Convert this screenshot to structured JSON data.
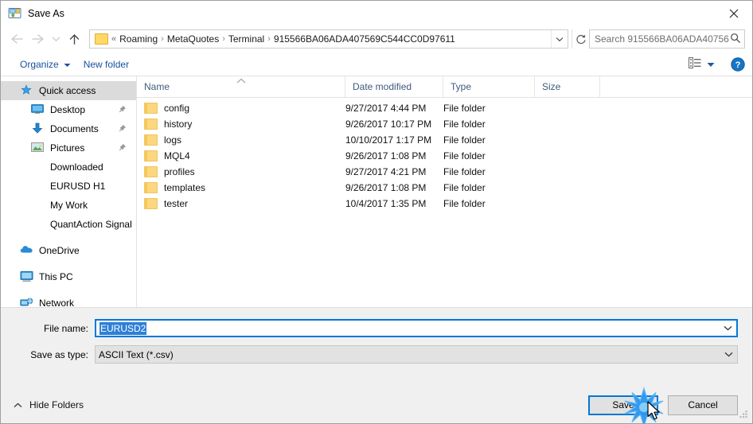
{
  "window": {
    "title": "Save As",
    "icon": "save-as-icon",
    "close_label": "✕"
  },
  "nav": {
    "back_icon": "arrow-left-icon",
    "forward_icon": "arrow-right-icon",
    "recent_icon": "chevron-down-icon",
    "up_icon": "arrow-up-icon",
    "refresh_icon": "refresh-icon",
    "address_chevron_icon": "chevron-down-icon",
    "breadcrumb_prefix": "«",
    "breadcrumbs": [
      "Roaming",
      "MetaQuotes",
      "Terminal",
      "915566BA06ADA407569C544CC0D97611"
    ],
    "separator": "›"
  },
  "search": {
    "placeholder": "Search 915566BA06ADA40756...",
    "icon": "search-icon"
  },
  "commandbar": {
    "organize_label": "Organize",
    "organize_arrow_icon": "caret-down-icon",
    "new_folder_label": "New folder",
    "view_icon": "view-layout-icon",
    "view_arrow_icon": "caret-down-icon",
    "help_icon": "help-icon"
  },
  "sidebar": {
    "items": [
      {
        "label": "Quick access",
        "icon": "star-pin-icon",
        "level": 1,
        "selected": true,
        "pinned": false
      },
      {
        "label": "Desktop",
        "icon": "desktop-icon",
        "level": 2,
        "selected": false,
        "pinned": true
      },
      {
        "label": "Documents",
        "icon": "documents-icon",
        "level": 2,
        "selected": false,
        "pinned": true
      },
      {
        "label": "Pictures",
        "icon": "pictures-icon",
        "level": 2,
        "selected": false,
        "pinned": true
      },
      {
        "label": "Downloaded",
        "icon": "folder-icon",
        "level": 2,
        "selected": false,
        "pinned": false
      },
      {
        "label": "EURUSD H1",
        "icon": "folder-icon",
        "level": 2,
        "selected": false,
        "pinned": false
      },
      {
        "label": "My Work",
        "icon": "folder-icon",
        "level": 2,
        "selected": false,
        "pinned": false
      },
      {
        "label": "QuantAction Signal",
        "icon": "folder-icon",
        "level": 2,
        "selected": false,
        "pinned": false
      },
      {
        "label": "OneDrive",
        "icon": "onedrive-icon",
        "level": 1,
        "selected": false,
        "pinned": false,
        "gap_before": true
      },
      {
        "label": "This PC",
        "icon": "this-pc-icon",
        "level": 1,
        "selected": false,
        "pinned": false,
        "gap_before": true
      },
      {
        "label": "Network",
        "icon": "network-icon",
        "level": 1,
        "selected": false,
        "pinned": false,
        "gap_before": true
      }
    ]
  },
  "filelist": {
    "columns": [
      "Name",
      "Date modified",
      "Type",
      "Size"
    ],
    "sort_column": "Name",
    "sort_icon": "sort-ascending-icon",
    "rows": [
      {
        "name": "config",
        "date": "9/27/2017 4:44 PM",
        "type": "File folder",
        "size": ""
      },
      {
        "name": "history",
        "date": "9/26/2017 10:17 PM",
        "type": "File folder",
        "size": ""
      },
      {
        "name": "logs",
        "date": "10/10/2017 1:17 PM",
        "type": "File folder",
        "size": ""
      },
      {
        "name": "MQL4",
        "date": "9/26/2017 1:08 PM",
        "type": "File folder",
        "size": ""
      },
      {
        "name": "profiles",
        "date": "9/27/2017 4:21 PM",
        "type": "File folder",
        "size": ""
      },
      {
        "name": "templates",
        "date": "9/26/2017 1:08 PM",
        "type": "File folder",
        "size": ""
      },
      {
        "name": "tester",
        "date": "10/4/2017 1:35 PM",
        "type": "File folder",
        "size": ""
      }
    ]
  },
  "form": {
    "filename_label": "File name:",
    "filename_value": "EURUSD2",
    "filename_selected": true,
    "filetype_label": "Save as type:",
    "filetype_value": "ASCII Text (*.csv)",
    "dropdown_icon": "chevron-down-icon"
  },
  "bottom": {
    "hide_folders_label": "Hide Folders",
    "hide_folders_icon": "chevron-up-icon",
    "save_label": "Save",
    "cancel_label": "Cancel",
    "resize_grip_icon": "resize-grip-icon",
    "cursor_icon": "mouse-pointer-icon",
    "click_burst_icon": "click-burst-icon"
  },
  "colors": {
    "accent": "#0078d7",
    "selection": "#2f7fd6",
    "link": "#16519e",
    "header_text": "#3f5a7d",
    "folder": "#fcd77f",
    "dialog_bg": "#f0f0f0"
  }
}
